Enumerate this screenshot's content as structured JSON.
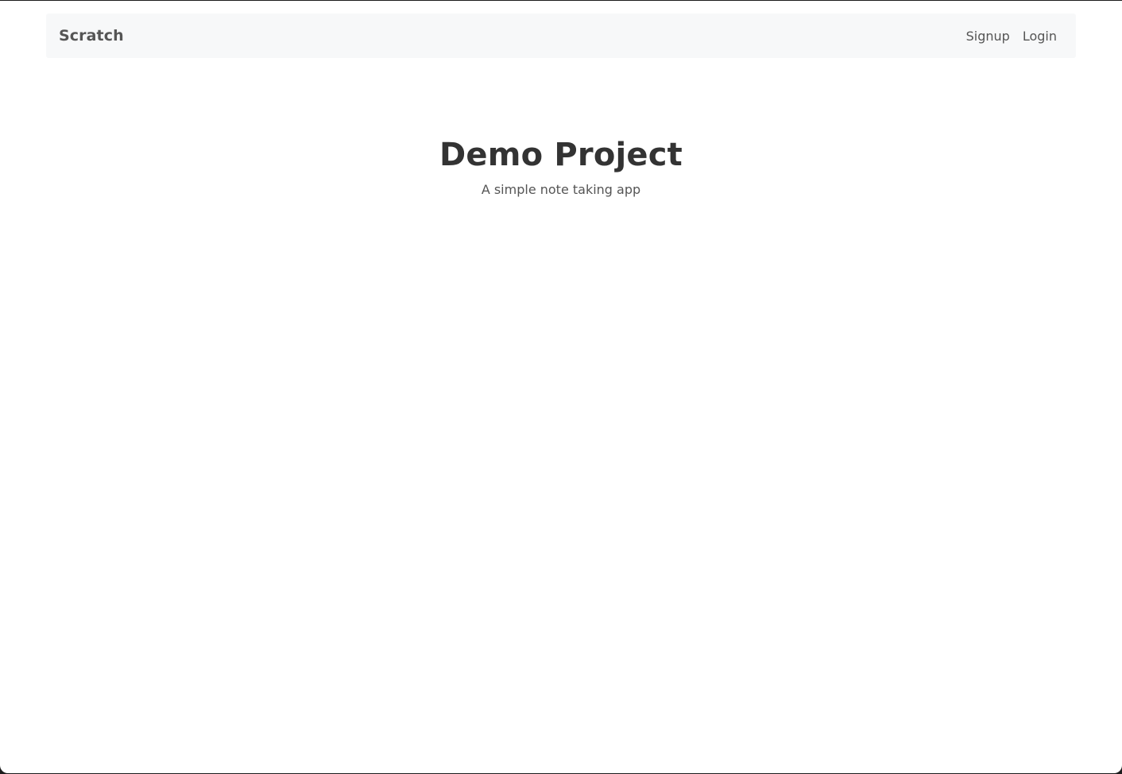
{
  "navbar": {
    "brand": "Scratch",
    "links": [
      {
        "label": "Signup"
      },
      {
        "label": "Login"
      }
    ]
  },
  "hero": {
    "title": "Demo Project",
    "subtitle": "A simple note taking app"
  },
  "colors": {
    "navbar_background": "#f7f8f9",
    "nav_text": "#555555",
    "title_text": "#333333",
    "page_background": "#ffffff"
  }
}
